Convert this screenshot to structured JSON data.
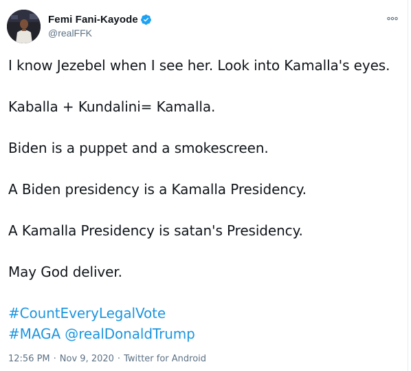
{
  "author": {
    "display_name": "Femi Fani-Kayode",
    "handle": "@realFFK",
    "verified": true,
    "avatar_icon": "profile-photo",
    "verified_icon": "verified-badge-icon",
    "more_icon": "more-options-icon"
  },
  "tweet": {
    "paragraphs": [
      "I know Jezebel when I see her. Look into Kamalla's eyes.",
      "Kaballa + Kundalini= Kamalla.",
      "Biden is a puppet and a smokescreen.",
      "A Biden presidency is a Kamalla Presidency.",
      "A Kamalla Presidency is satan's Presidency.",
      "May God deliver."
    ],
    "hashtag_1": "#CountEveryLegalVote",
    "hashtag_2": "#MAGA",
    "mention": "@realDonaldTrump"
  },
  "meta": {
    "time": "12:56 PM",
    "separator": "·",
    "date": "Nov 9, 2020",
    "source": "Twitter for Android"
  },
  "colors": {
    "link": "#1b95e0",
    "secondary_text": "#5b7083",
    "verified": "#1da1f2"
  }
}
